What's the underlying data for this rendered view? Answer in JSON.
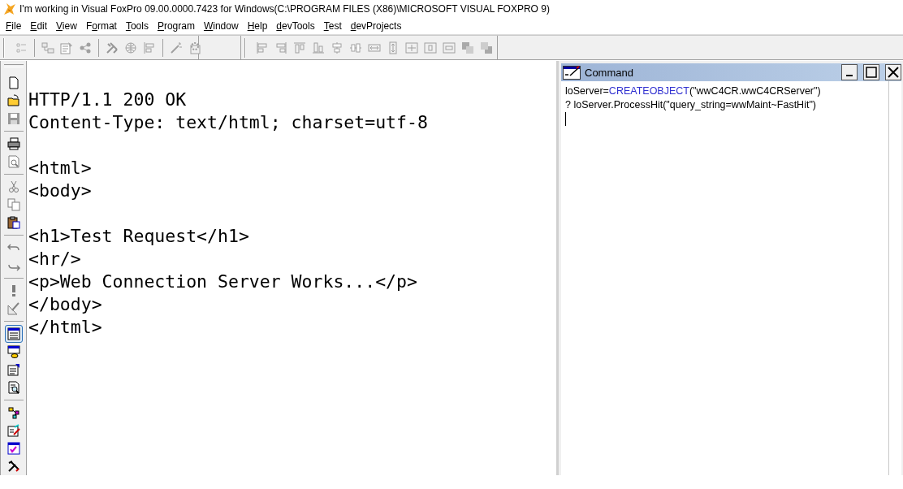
{
  "window": {
    "title": "I'm working in Visual FoxPro 09.00.0000.7423 for Windows(C:\\PROGRAM FILES (X86)\\MICROSOFT VISUAL FOXPRO 9)"
  },
  "menu": [
    {
      "parts": [
        {
          "text": "F",
          "underlined": true
        },
        {
          "text": "ile",
          "underlined": false
        }
      ]
    },
    {
      "parts": [
        {
          "text": "E",
          "underlined": true
        },
        {
          "text": "dit",
          "underlined": false
        }
      ]
    },
    {
      "parts": [
        {
          "text": "V",
          "underlined": true
        },
        {
          "text": "iew",
          "underlined": false
        }
      ]
    },
    {
      "parts": [
        {
          "text": "F",
          "underlined": false
        },
        {
          "text": "o",
          "underlined": true
        },
        {
          "text": "rmat",
          "underlined": false
        }
      ]
    },
    {
      "parts": [
        {
          "text": "T",
          "underlined": true
        },
        {
          "text": "ools",
          "underlined": false
        }
      ]
    },
    {
      "parts": [
        {
          "text": "P",
          "underlined": true
        },
        {
          "text": "rogram",
          "underlined": false
        }
      ]
    },
    {
      "parts": [
        {
          "text": "W",
          "underlined": true
        },
        {
          "text": "indow",
          "underlined": false
        }
      ]
    },
    {
      "parts": [
        {
          "text": "H",
          "underlined": true
        },
        {
          "text": "elp",
          "underlined": false
        }
      ]
    },
    {
      "parts": [
        {
          "text": "d",
          "underlined": true
        },
        {
          "text": "evTools",
          "underlined": false
        }
      ]
    },
    {
      "parts": [
        {
          "text": "T",
          "underlined": true
        },
        {
          "text": "est",
          "underlined": false
        }
      ]
    },
    {
      "parts": [
        {
          "text": "d",
          "underlined": true
        },
        {
          "text": "evProjects",
          "underlined": false
        }
      ]
    }
  ],
  "form_toolbar": [
    {
      "disabled": true
    },
    {
      "disabled": true
    },
    {
      "disabled": true
    },
    {
      "disabled": true
    },
    {
      "disabled": true
    },
    {
      "disabled": true
    },
    {
      "disabled": true
    },
    {
      "disabled": true
    },
    {
      "disabled": true
    }
  ],
  "layout_toolbar": [
    {
      "disabled": true
    },
    {
      "disabled": true
    },
    {
      "disabled": true
    },
    {
      "disabled": true
    },
    {
      "disabled": true
    },
    {
      "disabled": true
    },
    {
      "disabled": true
    },
    {
      "disabled": true
    },
    {
      "disabled": true
    },
    {
      "disabled": true
    },
    {
      "disabled": true
    },
    {
      "disabled": true
    },
    {
      "disabled": true
    }
  ],
  "standard_toolbar": [
    {
      "disabled": false,
      "selected": false
    },
    {
      "disabled": false,
      "selected": false
    },
    {
      "disabled": true,
      "selected": false
    },
    {
      "disabled": false,
      "selected": false
    },
    {
      "disabled": true,
      "selected": false
    },
    {
      "disabled": true,
      "selected": false
    },
    {
      "disabled": true,
      "selected": false
    },
    {
      "disabled": false,
      "selected": false
    },
    {
      "disabled": true,
      "selected": false
    },
    {
      "disabled": true,
      "selected": false
    },
    {
      "disabled": true,
      "selected": false
    },
    {
      "disabled": true,
      "selected": false
    },
    {
      "disabled": false,
      "selected": true
    },
    {
      "disabled": false,
      "selected": false
    },
    {
      "disabled": false,
      "selected": false
    },
    {
      "disabled": false,
      "selected": false
    },
    {
      "disabled": false,
      "selected": false
    },
    {
      "disabled": false,
      "selected": false
    },
    {
      "disabled": false,
      "selected": false
    },
    {
      "disabled": false,
      "selected": false
    }
  ],
  "editor": {
    "blocks": [
      [
        "HTTP/1.1 200 OK",
        "Content-Type: text/html; charset=utf-8"
      ],
      [
        "<html>",
        "<body>"
      ],
      [
        "<h1>Test Request</h1>",
        "<hr/>",
        "<p>Web Connection Server Works...</p>",
        "</body>",
        "</html>"
      ]
    ]
  },
  "command_window": {
    "title": "Command",
    "lines": [
      [
        {
          "text": "loServer=",
          "kind": "plain"
        },
        {
          "text": "CREATEOBJECT",
          "kind": "keyword"
        },
        {
          "text": "(\"wwC4CR.wwC4CRServer\")",
          "kind": "plain"
        }
      ],
      [
        {
          "text": "? loServer.ProcessHit(\"query_string=wwMaint~FastHit\")",
          "kind": "plain"
        }
      ]
    ]
  }
}
